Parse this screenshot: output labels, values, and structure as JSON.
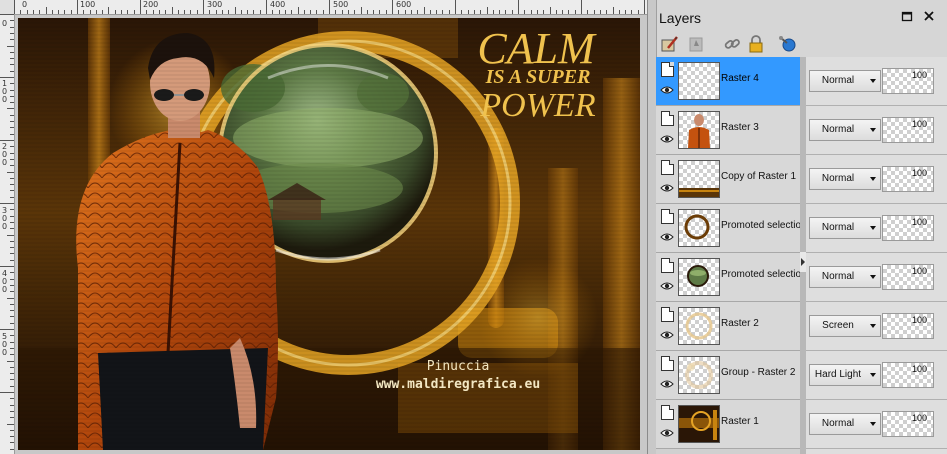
{
  "canvas": {
    "ruler_top_labels": [
      "0",
      "100",
      "200",
      "300",
      "400",
      "500",
      "600"
    ],
    "ruler_left_labels": [
      "0",
      "100",
      "200",
      "300",
      "400",
      "500"
    ],
    "artwork": {
      "headline_line1": "CALM",
      "headline_line2": "IS A SUPER",
      "headline_line3": "POWER",
      "signature_name": "Pinuccia",
      "signature_url": "www.maldiregrafica.eu"
    }
  },
  "panel": {
    "title": "Layers",
    "header_buttons": [
      "restore-icon",
      "close-icon"
    ],
    "toolbar_icons": [
      "edit-layer-icon",
      "mask-icon",
      "link-icon",
      "lock-icon",
      "globe-pin-icon"
    ]
  },
  "layers": [
    {
      "name": "Raster 4",
      "blend": "Normal",
      "opacity": "100",
      "selected": true,
      "thumb": "empty"
    },
    {
      "name": "Raster 3",
      "blend": "Normal",
      "opacity": "100",
      "selected": false,
      "thumb": "man"
    },
    {
      "name": "Copy of Raster 1",
      "blend": "Normal",
      "opacity": "100",
      "selected": false,
      "thumb": "strip"
    },
    {
      "name": "Promoted selectio",
      "blend": "Normal",
      "opacity": "100",
      "selected": false,
      "thumb": "ring"
    },
    {
      "name": "Promoted selectio",
      "blend": "Normal",
      "opacity": "100",
      "selected": false,
      "thumb": "orb"
    },
    {
      "name": "Raster 2",
      "blend": "Screen",
      "opacity": "100",
      "selected": false,
      "thumb": "faint-ring"
    },
    {
      "name": "Group - Raster 2",
      "blend": "Hard Light",
      "opacity": "100",
      "selected": false,
      "thumb": "faint-ring2"
    },
    {
      "name": "Raster 1",
      "blend": "Normal",
      "opacity": "100",
      "selected": false,
      "thumb": "background"
    }
  ],
  "colors": {
    "selection": "#3399ff",
    "gold": "#e8b94a",
    "jacket": "#c4520f"
  }
}
